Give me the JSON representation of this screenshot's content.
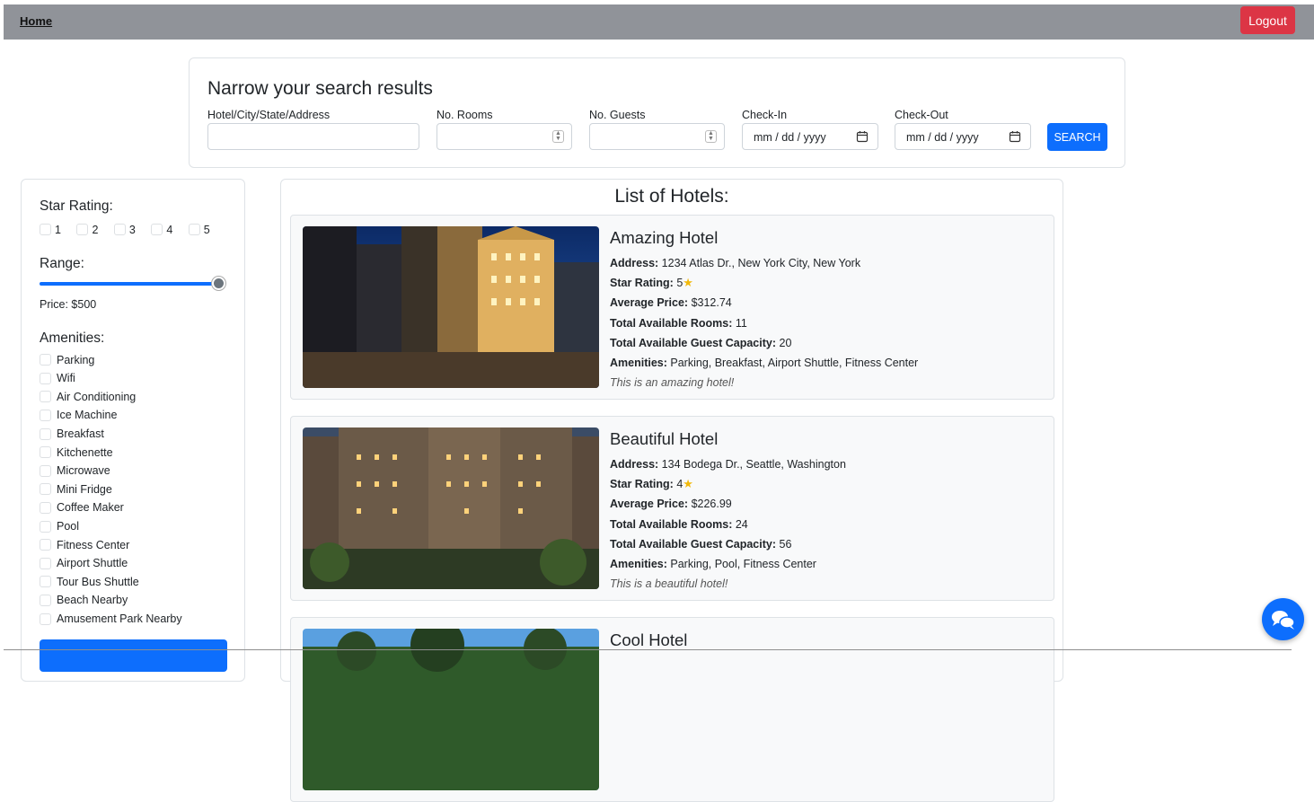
{
  "nav": {
    "home_label": "Home",
    "logout_label": "Logout"
  },
  "search": {
    "title": "Narrow your search results",
    "fields": {
      "location_label": "Hotel/City/State/Address",
      "rooms_label": "No. Rooms",
      "guests_label": "No. Guests",
      "checkin_label": "Check-In",
      "checkin_placeholder": "mm / dd / yyyy",
      "checkout_label": "Check-Out",
      "checkout_placeholder": "mm / dd / yyyy"
    },
    "button_label": "SEARCH"
  },
  "filters": {
    "star_heading": "Star Rating:",
    "stars": [
      "1",
      "2",
      "3",
      "4",
      "5"
    ],
    "range_heading": "Range:",
    "price_text": "Price: $500",
    "price_value": 500,
    "amenities_heading": "Amenities:",
    "amenities": [
      "Parking",
      "Wifi",
      "Air Conditioning",
      "Ice Machine",
      "Breakfast",
      "Kitchenette",
      "Microwave",
      "Mini Fridge",
      "Coffee Maker",
      "Pool",
      "Fitness Center",
      "Airport Shuttle",
      "Tour Bus Shuttle",
      "Beach Nearby",
      "Amusement Park Nearby"
    ]
  },
  "list": {
    "title": "List of Hotels:",
    "labels": {
      "address": "Address:",
      "star_rating": "Star Rating:",
      "avg_price": "Average Price:",
      "rooms": "Total Available Rooms:",
      "capacity": "Total Available Guest Capacity:",
      "amenities": "Amenities:"
    },
    "hotels": [
      {
        "name": "Amazing Hotel",
        "address": "1234 Atlas Dr., New York City, New York",
        "star_rating": "5",
        "avg_price": "$312.74",
        "rooms": "11",
        "capacity": "20",
        "amenities": "Parking, Breakfast, Airport Shuttle, Fitness Center",
        "description": "This is an amazing hotel!"
      },
      {
        "name": "Beautiful Hotel",
        "address": "134 Bodega Dr., Seattle, Washington",
        "star_rating": "4",
        "avg_price": "$226.99",
        "rooms": "24",
        "capacity": "56",
        "amenities": "Parking, Pool, Fitness Center",
        "description": "This is a beautiful hotel!"
      },
      {
        "name": "Cool Hotel"
      }
    ]
  },
  "colors": {
    "primary": "#0d6efd",
    "danger": "#dc3545",
    "nav": "#909399",
    "star": "#f2b90b"
  },
  "icons": {
    "calendar": "calendar-icon",
    "chat": "chat-bubbles-icon",
    "star": "star-icon"
  }
}
